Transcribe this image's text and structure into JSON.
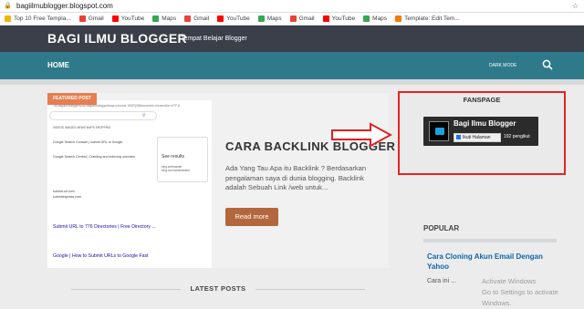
{
  "browser": {
    "url": "bagiilmublogger.blogspot.com",
    "bookmarks": [
      {
        "label": "Top 10 Free Templa...",
        "color": "#f4b400"
      },
      {
        "label": "Gmail",
        "color": "#ea4335"
      },
      {
        "label": "YouTube",
        "color": "#ff0000"
      },
      {
        "label": "Maps",
        "color": "#34a853"
      },
      {
        "label": "Gmail",
        "color": "#ea4335"
      },
      {
        "label": "YouTube",
        "color": "#ff0000"
      },
      {
        "label": "Maps",
        "color": "#34a853"
      },
      {
        "label": "Gmail",
        "color": "#ea4335"
      },
      {
        "label": "YouTube",
        "color": "#ff0000"
      },
      {
        "label": "Maps",
        "color": "#34a853"
      },
      {
        "label": "Template: Edit Tem...",
        "color": "#f57c00"
      }
    ]
  },
  "header": {
    "brand": "BAGI ILMU BLOGGER",
    "tagline": "Tempat Belajar Blogger"
  },
  "nav": {
    "home": "HOME",
    "dark_mode": "DARK MODE",
    "search_icon": "search-icon"
  },
  "featured": {
    "badge": "FEATURED POST",
    "title": "CARA BACKLINK BLOGGER",
    "excerpt": "Ada Yang Tau Apa itu Backlink ?  Berdasarkan pengalaman saya di dunia blogging. Backlink adalah Sebuah Link /web untuk...",
    "read_more": "Read more",
    "screenshot": {
      "url": "?q=bagiilmublogger&oq=bagiilmublogger&aqs=chrome..69i57j0l5&sourceid=chrome&ie=UTF-8",
      "tabs": "VIDEOS    IMAGES    NEWS    MAPS    SHOPPING",
      "lines": [
        "Google Search Console | submit URL to Google",
        "Google Search Central | Crawling and indexing overview",
        "submit-url.com",
        "submitexpress.com",
        "Submit URL to 776 Directories | Free Directory ...",
        "Google | How to Submit URLs to Google Fast"
      ],
      "side_title": "See results",
      "side_text": "bing.webmaster\nbing.com/webmasters"
    }
  },
  "latest": {
    "title": "LATEST POSTS"
  },
  "sidebar": {
    "fanspage_title": "FANSPAGE",
    "fb_name": "Bagi Ilmu Blogger",
    "fb_follow": "Ikuti Halaman",
    "fb_count": "192 pengikut",
    "popular_title": "POPULAR",
    "popular_item": "Cara Cloning Akun Email Dengan Yahoo",
    "popular_sub": "Cara ini ..."
  },
  "watermark": {
    "line1": "Activate Windows",
    "line2": "Go to Settings to activate Windows."
  }
}
